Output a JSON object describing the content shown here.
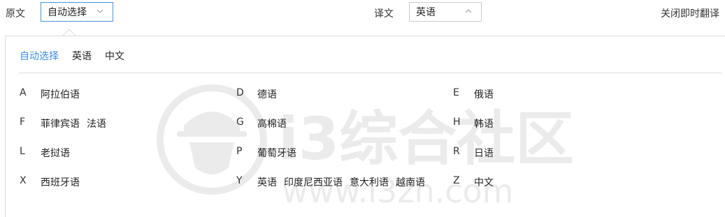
{
  "topbar": {
    "source_label": "原文",
    "source_value": "自动选择",
    "target_label": "译文",
    "target_value": "英语",
    "close_label": "关闭即时翻译"
  },
  "tabs": [
    "自动选择",
    "英语",
    "中文"
  ],
  "active_tab": 0,
  "groups": [
    {
      "letter": "A",
      "langs": [
        "阿拉伯语"
      ]
    },
    {
      "letter": "D",
      "langs": [
        "德语"
      ]
    },
    {
      "letter": "E",
      "langs": [
        "俄语"
      ]
    },
    {
      "letter": "F",
      "langs": [
        "菲律宾语",
        "法语"
      ]
    },
    {
      "letter": "G",
      "langs": [
        "高棉语"
      ]
    },
    {
      "letter": "H",
      "langs": [
        "韩语"
      ]
    },
    {
      "letter": "L",
      "langs": [
        "老挝语"
      ]
    },
    {
      "letter": "P",
      "langs": [
        "葡萄牙语"
      ]
    },
    {
      "letter": "R",
      "langs": [
        "日语"
      ]
    },
    {
      "letter": "X",
      "langs": [
        "西班牙语"
      ]
    },
    {
      "letter": "Y",
      "langs": [
        "英语",
        "印度尼西亚语",
        "意大利语",
        "越南语"
      ]
    },
    {
      "letter": "Z",
      "langs": [
        "中文"
      ]
    }
  ],
  "watermark": {
    "brand": "i3综合社区",
    "url": "www.i3zh.com"
  },
  "colors": {
    "accent": "#3a8ee6",
    "border": "#dddddd",
    "watermark": "#e6e6e6"
  }
}
